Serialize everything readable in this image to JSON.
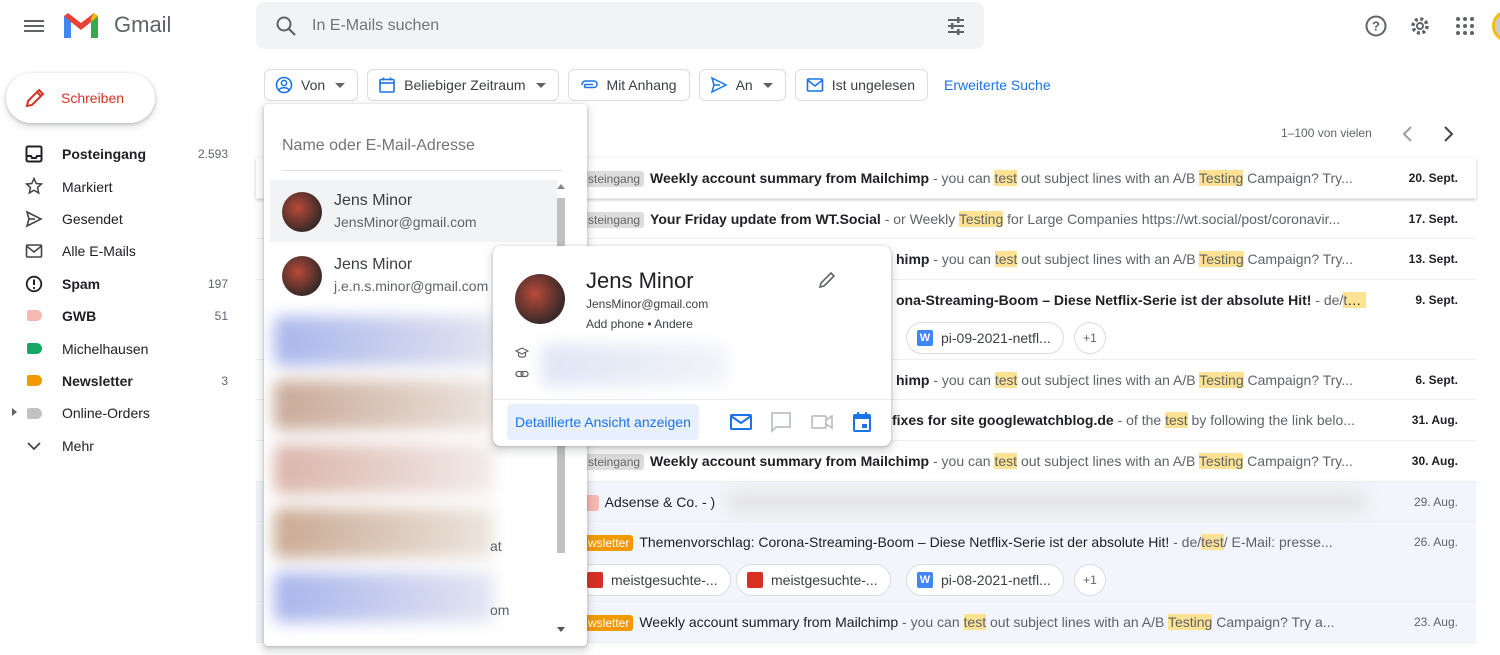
{
  "app": {
    "name": "Gmail",
    "colors": {
      "accent": "#1a73e8",
      "compose_red": "#d93025",
      "highlight": "#fde293",
      "newsletter": "#f29900"
    }
  },
  "search": {
    "placeholder": "In E-Mails suchen"
  },
  "compose": {
    "label": "Schreiben"
  },
  "nav": [
    {
      "label": "Posteingang",
      "count": "2.593",
      "bold": true,
      "icon": "inbox-icon"
    },
    {
      "label": "Markiert",
      "count": "",
      "bold": false,
      "icon": "star-icon"
    },
    {
      "label": "Gesendet",
      "count": "",
      "bold": false,
      "icon": "send-icon"
    },
    {
      "label": "Alle E-Mails",
      "count": "",
      "bold": false,
      "icon": "mail-icon"
    },
    {
      "label": "Spam",
      "count": "197",
      "bold": true,
      "icon": "spam-icon"
    },
    {
      "label": "GWB",
      "count": "51",
      "bold": true,
      "icon": "label-icon",
      "color": "#f6b8b2"
    },
    {
      "label": "Michelhausen",
      "count": "",
      "bold": false,
      "icon": "label-icon",
      "color": "#16a765"
    },
    {
      "label": "Newsletter",
      "count": "3",
      "bold": true,
      "icon": "label-icon",
      "color": "#f29900"
    },
    {
      "label": "Online-Orders",
      "count": "",
      "bold": false,
      "icon": "label-icon",
      "color": "#c2c2c2"
    },
    {
      "label": "Mehr",
      "count": "",
      "bold": false,
      "icon": "chevron-down-icon"
    }
  ],
  "filters": {
    "von": "Von",
    "zeitraum": "Beliebiger Zeitraum",
    "anhang": "Mit Anhang",
    "an": "An",
    "ungelesen": "Ist ungelesen",
    "erweitert": "Erweiterte Suche"
  },
  "pager": {
    "text": "1–100 von vielen"
  },
  "dropdown": {
    "placeholder": "Name oder E-Mail-Adresse",
    "contacts": [
      {
        "name": "Jens Minor",
        "email": "JensMinor@gmail.com"
      },
      {
        "name": "Jens Minor",
        "email": "j.e.n.s.minor@gmail.com"
      }
    ],
    "fragments": {
      "at": "at",
      "om": "om"
    }
  },
  "card": {
    "name": "Jens Minor",
    "email": "JensMinor@gmail.com",
    "phone": "Add phone • Andere",
    "detail_button": "Detaillierte Ansicht anzeigen"
  },
  "rows": [
    {
      "tag": "steingang",
      "subject": "Weekly account summary from Mailchimp",
      "snippet_parts": [
        " - you can ",
        "test",
        " out subject lines with an A/B ",
        "Testing",
        " Campaign? Try..."
      ],
      "date": "20. Sept."
    },
    {
      "tag": "steingang",
      "subject": "Your Friday update from WT.Social",
      "snippet_parts": [
        " - or Weekly ",
        "Testing",
        " for Large Companies https://wt.social/post/coronavir..."
      ],
      "date": "17. Sept."
    },
    {
      "tag": "",
      "subject": "himp",
      "snippet_parts": [
        " - you can ",
        "test",
        " out subject lines with an A/B ",
        "Testing",
        " Campaign? Try..."
      ],
      "date": "13. Sept."
    },
    {
      "tag": "",
      "subject": "ona-Streaming-Boom – Diese Netflix-Serie ist der absolute Hit!",
      "snippet_parts": [
        " - de/",
        "te..."
      ],
      "date": "9. Sept.",
      "attachments": [
        "pi-09-2021-netfl...",
        "+1"
      ]
    },
    {
      "tag": "",
      "subject": "himp",
      "snippet_parts": [
        " - you can ",
        "test",
        " out subject lines with an A/B ",
        "Testing",
        " Campaign? Try..."
      ],
      "date": "6. Sept."
    },
    {
      "tag": "",
      "subject": "fixes for site googlewatchblog.de",
      "snippet_parts": [
        " - of the ",
        "test",
        " by following the link belo..."
      ],
      "date": "31. Aug."
    },
    {
      "tag": "steingang",
      "subject": "Weekly account summary from Mailchimp",
      "snippet_parts": [
        " - you can ",
        "test",
        " out subject lines with an A/B ",
        "Testing",
        " Campaign? Try..."
      ],
      "date": "30. Aug."
    },
    {
      "tag": "",
      "subject": "Adsense & Co. - )",
      "snippet_parts": [],
      "date": "29. Aug."
    },
    {
      "tag": "wsletter",
      "subject": "Themenvorschlag: Corona-Streaming-Boom – Diese Netflix-Serie ist der absolute Hit!",
      "snippet_parts": [
        " - de/",
        "test",
        "/ E-Mail: presse..."
      ],
      "date": "26. Aug.",
      "attachments": [
        "meistgesuchte-...",
        "meistgesuchte-...",
        "pi-08-2021-netfl...",
        "+1"
      ]
    },
    {
      "tag": "wsletter",
      "subject": "Weekly account summary from Mailchimp",
      "snippet_parts": [
        " - you can ",
        "test",
        " out subject lines with an A/B ",
        "Testing",
        " Campaign? Try a..."
      ],
      "date": "23. Aug."
    }
  ]
}
